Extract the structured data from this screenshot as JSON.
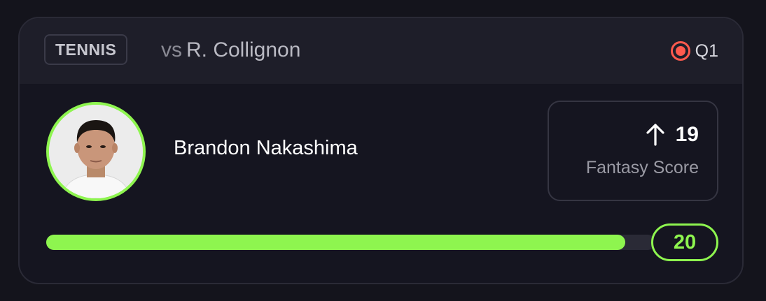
{
  "header": {
    "sport": "TENNIS",
    "vs_prefix": "vs",
    "opponent": "R. Collignon",
    "status": {
      "icon": "live-record-icon",
      "period": "Q1"
    }
  },
  "player": {
    "name": "Brandon Nakashima",
    "avatar": "player-headshot"
  },
  "fantasy_score": {
    "direction": "up",
    "value": "19",
    "label": "Fantasy Score"
  },
  "progress": {
    "target": "20",
    "current": 19,
    "fraction": 0.95
  },
  "colors": {
    "accent": "#8ef54f",
    "live": "#ff5a4e",
    "background": "#14141c",
    "card": "#151520",
    "header": "#1e1e29"
  }
}
